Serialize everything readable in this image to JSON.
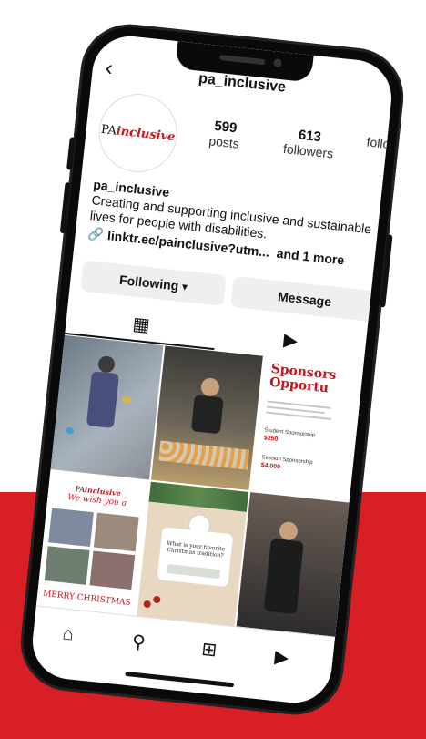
{
  "profile": {
    "username": "pa_inclusive",
    "display_name": "pa_inclusive",
    "bio": "Creating and supporting inclusive and sustainable lives for people with disabilities.",
    "link_text": "linktr.ee/painclusive?utm...",
    "link_more": "and 1 more",
    "avatar_logo_prefix": "PA",
    "avatar_logo_word": "inclusive"
  },
  "stats": [
    {
      "value": "599",
      "label": "posts"
    },
    {
      "value": "613",
      "label": "followers"
    },
    {
      "value": "",
      "label": "following"
    }
  ],
  "actions": {
    "following_label": "Following",
    "message_label": "Message"
  },
  "icons": {
    "back": "chevron-left-icon",
    "grid_tab": "grid-icon",
    "reels_tab": "reels-icon",
    "home": "home-icon",
    "search": "search-icon",
    "new_post": "plus-square-icon",
    "reels_nav": "reels-icon"
  },
  "posts": {
    "sponsor_title_1": "Sponsors",
    "sponsor_title_2": "Opportu",
    "sponsor_student": "Student Sponsorship",
    "sponsor_student_amount": "$250",
    "sponsor_session": "Session Sponsorship",
    "sponsor_session_amount": "$4,000",
    "xmas_wish": "We wish you a",
    "xmas_merry": "MERRY CHRISTMAS",
    "question": "What is your favorite Christmas tradition?"
  },
  "colors": {
    "brand_red": "#d81f26",
    "phone_black": "#0a0a0a"
  }
}
